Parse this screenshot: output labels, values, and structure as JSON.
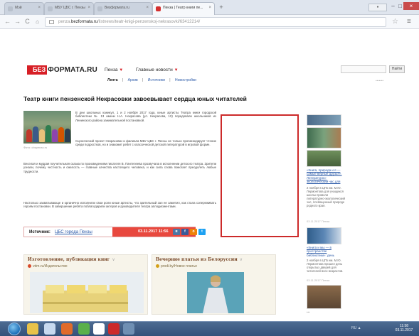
{
  "browser": {
    "tabs": [
      {
        "label": "Мэй"
      },
      {
        "label": "МБУ ЦБС г. Пензы"
      },
      {
        "label": "Bезформата.ru"
      },
      {
        "label": "Пенза | Театр книги пе..."
      }
    ],
    "new_tab": "+",
    "window_controls": [
      "–",
      "□",
      "×"
    ],
    "address": {
      "prefix": "penza.",
      "domain": "bezformata.ru",
      "path": "/listnews/teatr-knigi-penzenskoj-nekrasovki/63412214/"
    }
  },
  "site": {
    "logo": {
      "red": "БЕЗ",
      "dark": "ФОРМАТА.RU"
    },
    "nav": {
      "city": "Пенза",
      "news": "Главные новости"
    },
    "subnav": [
      "Лента",
      "Архив",
      "Источники",
      "Новостройки"
    ],
    "search": {
      "button": "Найти"
    }
  },
  "article": {
    "title": "Театр книги пензенской Некрасовки завоевывает сердца юных читателей",
    "photo_caption": "Фото: cbspenza.ru",
    "paragraphs": [
      "В дни школьных каникул, 1 и 2 ноября 2017 года, юные артисты Театра книги городской библиотеки № 13 имени Н.А. Некрасова (ул. Некрасова, 10) порадовали школьников из Ленинского района занимательной постановкой.",
      "Сценический проект Некрасовки и филиала МБУ ЦБС г. Пензы не только пропагандирует чтение среди подростков, но и знакомит ребят с классической детской литературой в игровой форме.",
      "Веселая и мудрая поучительная сказка по произведениям писателя В. Пантелеева прозвучала в исполнении детского театра. Зрители узнали, почему честность и смелость — главные качества настоящего человека, и как сила слова помогает преодолеть любые трудности.",
      "Настолько захватывающе и органично исполнили свои роли юные артисты, что зрительный зал не заметил, как стала сопереживать героям постановки. В завершение ребята поблагодарили актеров и руководителя театра аплодисментами."
    ],
    "source_label": "Источник:",
    "source_value": "ЦБС города Пензы",
    "date": "03.11.2017 11:56",
    "share": [
      "vk",
      "f",
      "ok",
      "tw"
    ]
  },
  "blocks": [
    {
      "title": "Изготовление, публикация книг",
      "subtitle": "vdm.ru/Издательство"
    },
    {
      "title": "Вечерние платья из Белоруссии",
      "subtitle": "prodi.by/Новое платье"
    }
  ],
  "sidebar": [
    {
      "link": "«Книга, природа и я — самые верные друзья». Литературно-экологический час для школьников",
      "text": "2 ноября в ЦГБ им. М.Ю. Лермонтова для учащихся школы провели литературно-экологический час, посвященный природе родного края.",
      "date": "03.11.2017 Пенза"
    },
    {
      "link": "«Книга и мы — в пространстве библиотеки»: день открытых дверей",
      "text": "2 ноября в ЦГБ им. М.Ю. Лермонтова прошел день открытых дверей для читателей всех возрастов.",
      "date": "03.11.2017 Пенза"
    }
  ],
  "taskbar": {
    "clock_time": "11:58",
    "clock_date": "03.11.2017",
    "tray": "RU ▲"
  }
}
